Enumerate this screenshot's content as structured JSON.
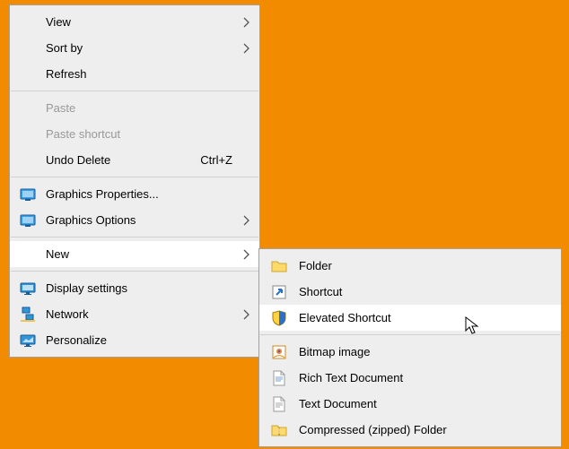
{
  "menu1": {
    "view": "View",
    "sort_by": "Sort by",
    "refresh": "Refresh",
    "paste": "Paste",
    "paste_shortcut": "Paste shortcut",
    "undo_delete": "Undo Delete",
    "undo_delete_key": "Ctrl+Z",
    "graphics_properties": "Graphics Properties...",
    "graphics_options": "Graphics Options",
    "new": "New",
    "display_settings": "Display settings",
    "network": "Network",
    "personalize": "Personalize"
  },
  "menu2": {
    "folder": "Folder",
    "shortcut": "Shortcut",
    "elevated_shortcut": "Elevated Shortcut",
    "bitmap_image": "Bitmap image",
    "rich_text_document": "Rich Text Document",
    "text_document": "Text Document",
    "compressed_folder": "Compressed (zipped) Folder"
  }
}
